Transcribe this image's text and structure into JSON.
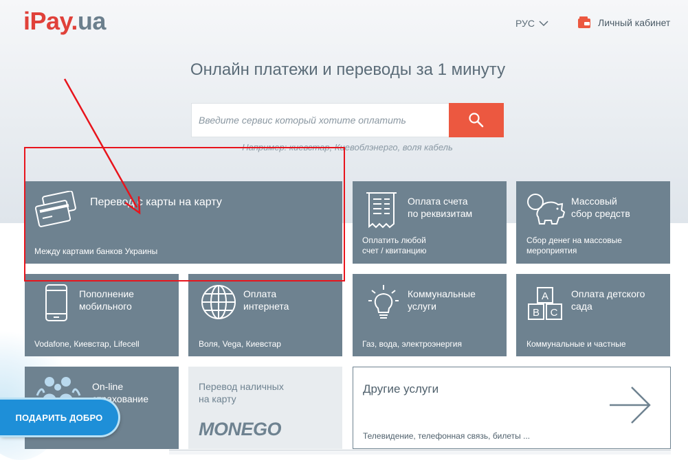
{
  "brand": {
    "logo_part1": "iPay",
    "logo_dot": ".",
    "logo_part2": "ua",
    "color_red": "#e0413a",
    "color_slate": "#6b7f8d"
  },
  "header": {
    "language": "РУС",
    "cabinet_label": "Личный кабинет"
  },
  "hero": {
    "headline": "Онлайн платежи и переводы за 1 минуту",
    "search_placeholder": "Введите сервис который хотите оплатить",
    "example_text": "Например: киевстар, Киевоблэнерго, воля кабель"
  },
  "tiles": {
    "card_transfer": {
      "title": "Перевод с карты на карту",
      "subtitle": "Между картами банков Украины",
      "icon": "credit-cards-icon"
    },
    "invoice": {
      "title1": "Оплата счета",
      "title2": "по реквизитам",
      "sub1": "Оплатить любой",
      "sub2": "счет / квитанцию",
      "icon": "receipt-icon"
    },
    "mass_collect": {
      "title1": "Массовый",
      "title2": "сбор средств",
      "sub1": "Сбор денег на массовые",
      "sub2": "мероприятия",
      "icon": "piggy-bank-icon"
    },
    "mobile": {
      "title1": "Пополнение",
      "title2": "мобильного",
      "subtitle": "Vodafone, Киевстар, Lifecell",
      "icon": "smartphone-icon"
    },
    "internet": {
      "title1": "Оплата",
      "title2": "интернета",
      "subtitle": "Воля, Vega, Киевстар",
      "icon": "globe-icon"
    },
    "utilities": {
      "title1": "Коммунальные",
      "title2": "услуги",
      "subtitle": "Газ, вода, электроэнергия",
      "icon": "light-bulb-icon"
    },
    "kindergarten": {
      "title1": "Оплата детского",
      "title2": "сада",
      "subtitle": "Коммунальные и частные",
      "icon": "abc-blocks-icon"
    },
    "insurance": {
      "title1": "On-line",
      "title2": "страхование",
      "icon": "family-icon"
    },
    "monego": {
      "title1": "Перевод наличных",
      "title2": "на карту",
      "logo": "MONEGO"
    },
    "other": {
      "title": "Другие услуги",
      "subtitle": "Телевидение, телефонная связь, билеты ...",
      "icon": "arrow-right-icon"
    }
  },
  "promo": {
    "gift_button": "ПОДАРИТЬ ДОБРО"
  },
  "colors": {
    "tile_bg": "#6e8290",
    "search_button": "#ec5840",
    "annotation": "#e8141c",
    "gift_button": "#1e8fd8"
  }
}
